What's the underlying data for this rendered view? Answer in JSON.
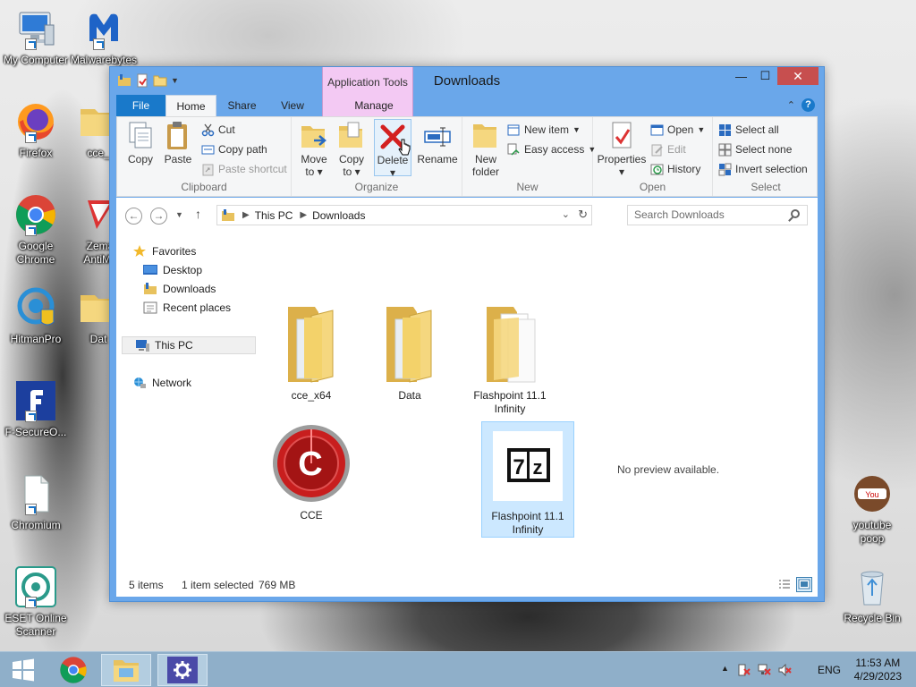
{
  "desktop": {
    "icons": [
      {
        "label": "My Computer",
        "icon": "computer-icon"
      },
      {
        "label": "Malwarebytes",
        "icon": "malwarebytes-icon"
      },
      {
        "label": "Firefox",
        "icon": "firefox-icon"
      },
      {
        "label": "cce_",
        "icon": "folder-icon"
      },
      {
        "label": "Google Chrome",
        "icon": "chrome-icon"
      },
      {
        "label": "Zema AntiMa",
        "icon": "zemana-icon"
      },
      {
        "label": "HitmanPro",
        "icon": "hitmanpro-icon"
      },
      {
        "label": "Dat",
        "icon": "folder-icon"
      },
      {
        "label": "F-SecureO...",
        "icon": "fsecure-icon"
      },
      {
        "label": "Chromium",
        "icon": "file-icon"
      },
      {
        "label": "ESET Online Scanner",
        "icon": "eset-icon"
      },
      {
        "label": "youtube poop",
        "icon": "youtube-icon"
      },
      {
        "label": "Recycle Bin",
        "icon": "recycle-bin-icon"
      }
    ]
  },
  "window": {
    "title": "Downloads",
    "context_tab_group": "Application Tools",
    "tabs": [
      "File",
      "Home",
      "Share",
      "View",
      "Manage"
    ],
    "controls": {
      "minimize": "—",
      "maximize": "☐",
      "close": "✕",
      "help": "?"
    }
  },
  "ribbon": {
    "clipboard": {
      "name": "Clipboard",
      "copy": "Copy",
      "paste": "Paste",
      "cut": "Cut",
      "copy_path": "Copy path",
      "paste_shortcut": "Paste shortcut"
    },
    "organize": {
      "name": "Organize",
      "move_to": "Move",
      "move_to_2": "to",
      "copy_to": "Copy",
      "copy_to_2": "to",
      "delete": "Delete",
      "rename": "Rename"
    },
    "new": {
      "name": "New",
      "new_folder": "New",
      "new_folder_2": "folder",
      "new_item": "New item",
      "easy_access": "Easy access"
    },
    "open": {
      "name": "Open",
      "properties": "Properties",
      "open": "Open",
      "edit": "Edit",
      "history": "History"
    },
    "select": {
      "name": "Select",
      "select_all": "Select all",
      "select_none": "Select none",
      "invert": "Invert selection"
    }
  },
  "navigation": {
    "address": [
      "This PC",
      "Downloads"
    ],
    "search_placeholder": "Search Downloads"
  },
  "navpane": {
    "favorites": "Favorites",
    "desktop": "Desktop",
    "downloads": "Downloads",
    "recent": "Recent places",
    "this_pc": "This PC",
    "network": "Network"
  },
  "files": [
    {
      "name": "cce_x64",
      "type": "folder"
    },
    {
      "name": "Data",
      "type": "folder"
    },
    {
      "name": "Flashpoint 11.1 Infinity",
      "type": "folder"
    },
    {
      "name": "CCE",
      "type": "app"
    },
    {
      "name": "Flashpoint 11.1 Infinity",
      "type": "7z archive",
      "selected": true
    }
  ],
  "preview": "No preview available.",
  "status": {
    "items": "5 items",
    "selection": "1 item selected",
    "size": "769 MB"
  },
  "taskbar": {
    "lang": "ENG",
    "time": "11:53 AM",
    "date": "4/29/2023"
  }
}
